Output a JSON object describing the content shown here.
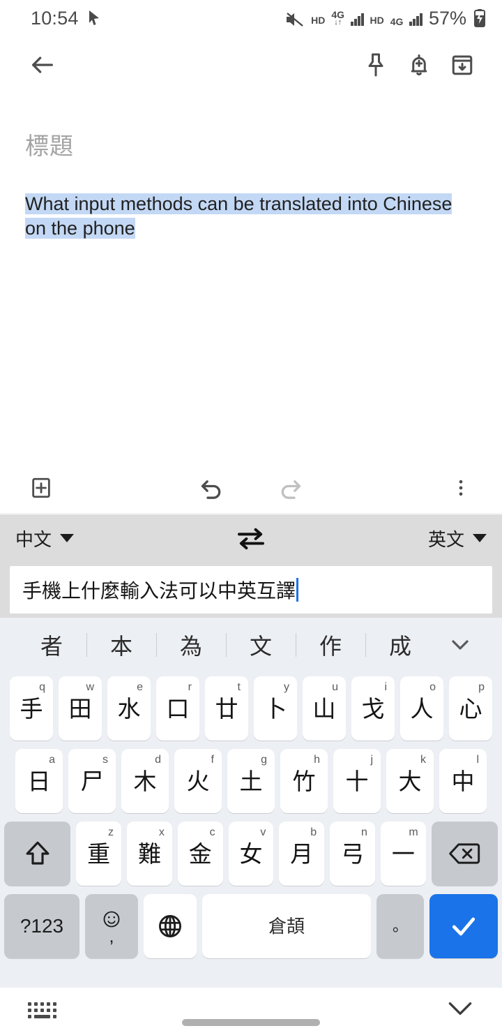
{
  "status_bar": {
    "time": "10:54",
    "cursor_icon": "cursor-arrow-icon",
    "mute_icon": "volume-mute-icon",
    "sim1": {
      "hd": "HD",
      "network": "4G",
      "data_arrows": "↓↑",
      "signal_bars": 4
    },
    "sim2": {
      "hd": "HD",
      "network": "4G",
      "signal_bars": 4
    },
    "battery_percent": "57%",
    "battery_state": "charging"
  },
  "app_bar": {
    "back_icon": "back-arrow-icon",
    "pin_icon": "pin-icon",
    "reminder_icon": "add-reminder-bell-icon",
    "archive_icon": "archive-icon"
  },
  "note": {
    "title_placeholder": "標題",
    "body_text": "What input methods can be translated into Chinese on the phone",
    "selection_color": "#c3d8f5"
  },
  "note_toolbar": {
    "add_icon": "add-box-icon",
    "undo_icon": "undo-icon",
    "redo_icon": "redo-icon",
    "more_icon": "more-vertical-icon",
    "undo_enabled": true,
    "redo_enabled": false
  },
  "translate_bar": {
    "source_language": "中文",
    "target_language": "英文",
    "swap_icon": "swap-horizontal-icon",
    "background": "#dcdcdc"
  },
  "translate_input": {
    "value": "手機上什麼輸入法可以中英互譯",
    "cursor_color": "#1a73e8"
  },
  "keyboard": {
    "layout_name": "倉頡",
    "candidates": [
      "者",
      "本",
      "為",
      "文",
      "作",
      "成"
    ],
    "candidate_expand_icon": "chevron-down-icon",
    "row1": [
      {
        "glyph": "手",
        "latin": "q"
      },
      {
        "glyph": "田",
        "latin": "w"
      },
      {
        "glyph": "水",
        "latin": "e"
      },
      {
        "glyph": "口",
        "latin": "r"
      },
      {
        "glyph": "廿",
        "latin": "t"
      },
      {
        "glyph": "卜",
        "latin": "y"
      },
      {
        "glyph": "山",
        "latin": "u"
      },
      {
        "glyph": "戈",
        "latin": "i"
      },
      {
        "glyph": "人",
        "latin": "o"
      },
      {
        "glyph": "心",
        "latin": "p"
      }
    ],
    "row2": [
      {
        "glyph": "日",
        "latin": "a"
      },
      {
        "glyph": "尸",
        "latin": "s"
      },
      {
        "glyph": "木",
        "latin": "d"
      },
      {
        "glyph": "火",
        "latin": "f"
      },
      {
        "glyph": "土",
        "latin": "g"
      },
      {
        "glyph": "竹",
        "latin": "h"
      },
      {
        "glyph": "十",
        "latin": "j"
      },
      {
        "glyph": "大",
        "latin": "k"
      },
      {
        "glyph": "中",
        "latin": "l"
      }
    ],
    "row3": [
      {
        "glyph": "重",
        "latin": "z"
      },
      {
        "glyph": "難",
        "latin": "x"
      },
      {
        "glyph": "金",
        "latin": "c"
      },
      {
        "glyph": "女",
        "latin": "v"
      },
      {
        "glyph": "月",
        "latin": "b"
      },
      {
        "glyph": "弓",
        "latin": "n"
      },
      {
        "glyph": "一",
        "latin": "m"
      }
    ],
    "shift_icon": "shift-up-arrow-icon",
    "backspace_icon": "backspace-icon",
    "symbols_key": "?123",
    "emoji_icon": "emoji-smiley-icon",
    "comma_key": ",",
    "globe_icon": "globe-language-icon",
    "space_label": "倉頡",
    "period_key": "。",
    "enter_icon": "checkmark-icon",
    "enter_color": "#1a73e8"
  },
  "nav_bar": {
    "keyboard_switch_icon": "keyboard-switch-icon",
    "home_gesture_bar": "home-indicator",
    "hide_keyboard_icon": "chevron-down-icon"
  }
}
